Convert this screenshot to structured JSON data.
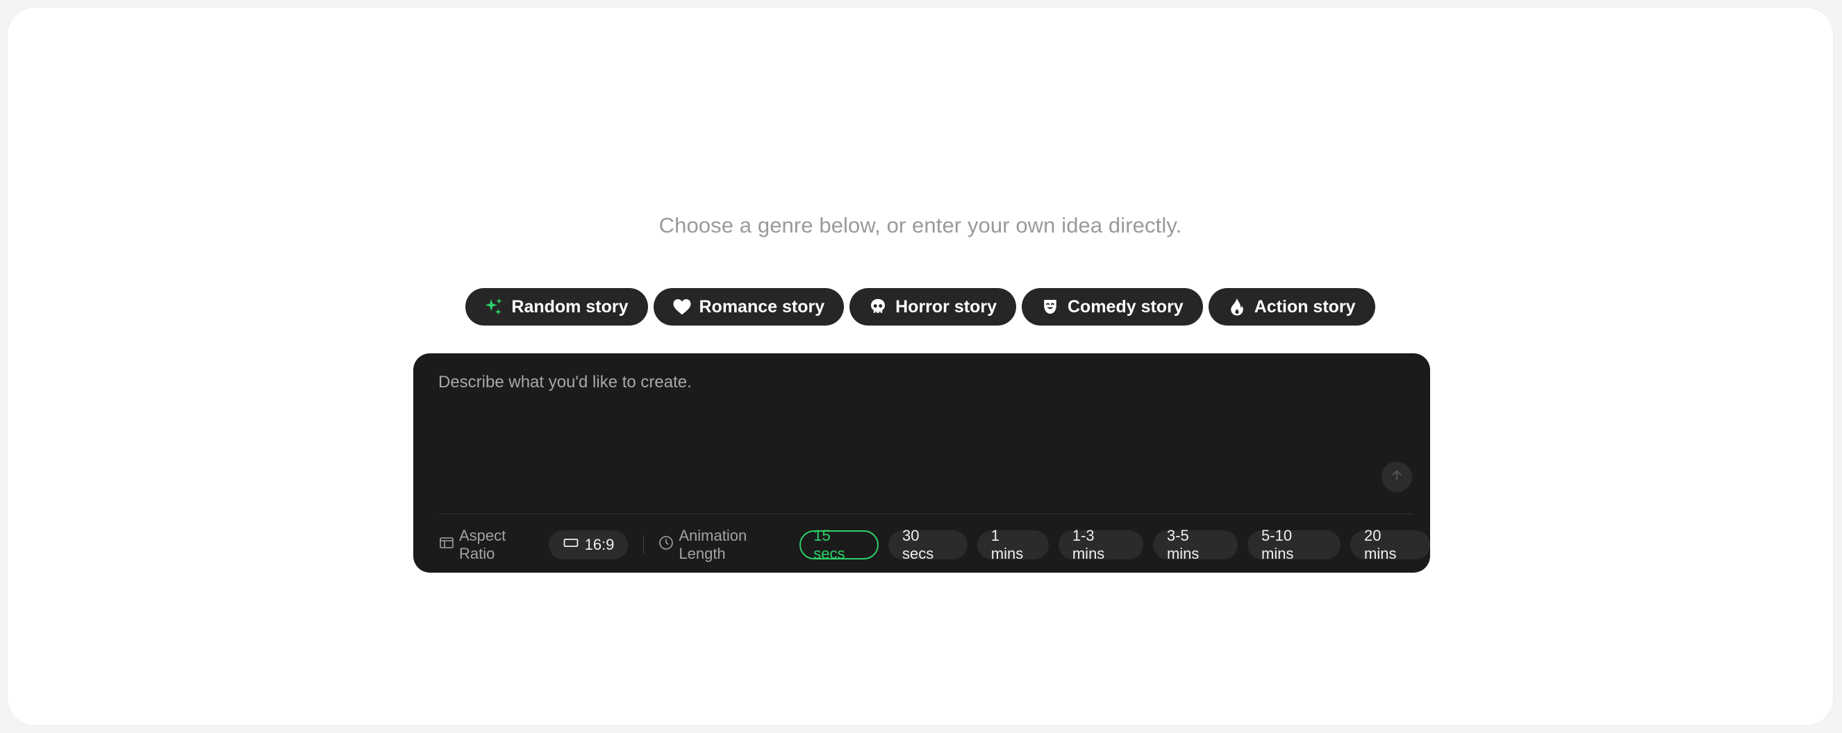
{
  "headline": "Choose a genre below, or enter your own idea directly.",
  "genres": [
    {
      "label": "Random story",
      "icon": "sparkles-icon"
    },
    {
      "label": "Romance story",
      "icon": "heart-icon"
    },
    {
      "label": "Horror story",
      "icon": "skull-icon"
    },
    {
      "label": "Comedy story",
      "icon": "mask-icon"
    },
    {
      "label": "Action story",
      "icon": "flame-icon"
    }
  ],
  "composer": {
    "placeholder": "Describe what you'd like to create."
  },
  "aspect_ratio": {
    "label": "Aspect Ratio",
    "value": "16:9"
  },
  "animation_length": {
    "label": "Animation Length",
    "options": [
      "15 secs",
      "30 secs",
      "1 mins",
      "1-3 mins",
      "3-5 mins",
      "5-10 mins",
      "20 mins"
    ],
    "selected": "15 secs"
  },
  "colors": {
    "accent": "#2bd168",
    "panel": "#1b1b1b",
    "chip": "#2b2b2b",
    "genre_pill": "#262626"
  }
}
